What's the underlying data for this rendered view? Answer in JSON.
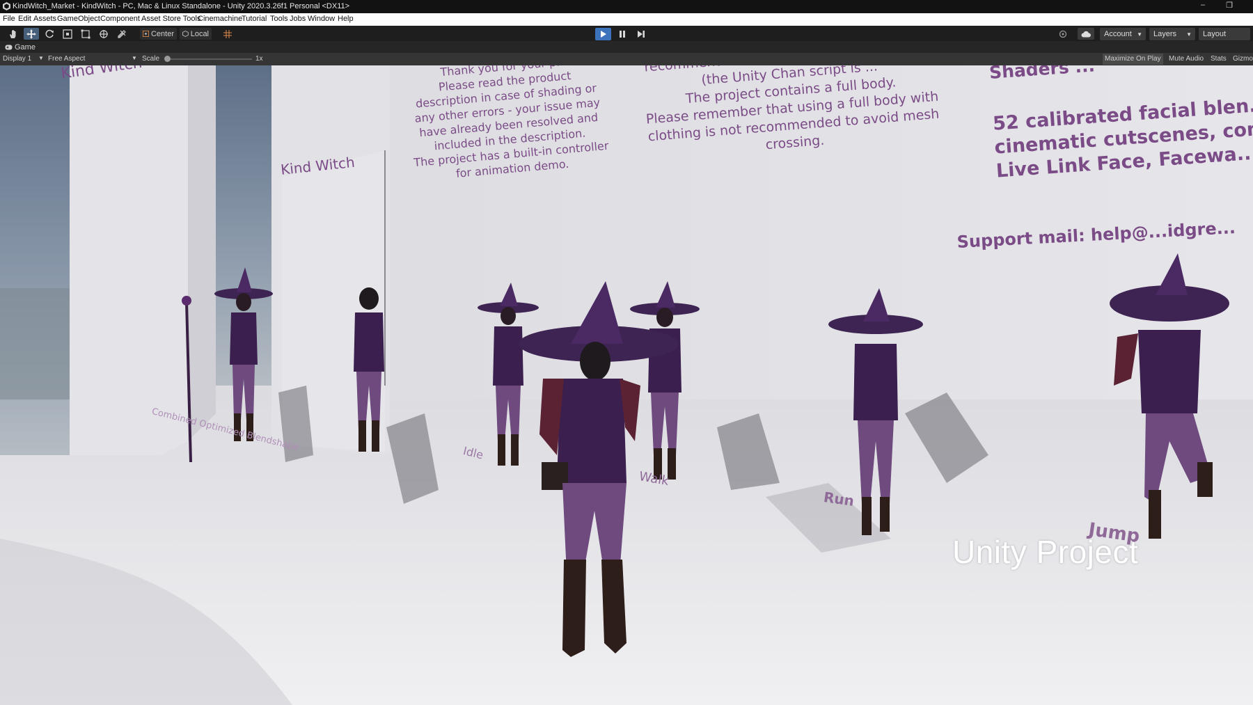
{
  "window": {
    "title": "KindWitch_Market - KindWitch - PC, Mac & Linux Standalone - Unity 2020.3.26f1 Personal <DX11>",
    "minimize_glyph": "–",
    "restore_glyph": "❐"
  },
  "menu": [
    "File",
    "Edit",
    "Assets",
    "GameObject",
    "Component",
    "Asset Store Tools",
    "Cinemachine",
    "Tutorial",
    "Tools",
    "Jobs",
    "Window",
    "Help"
  ],
  "toolbar": {
    "tools": [
      "hand-icon",
      "move-icon",
      "rotate-icon",
      "scale-icon",
      "rect-icon",
      "transform-icon",
      "custom-tool-icon"
    ],
    "pivot_label": "Center",
    "space_label": "Local",
    "account_label": "Account",
    "layers_label": "Layers",
    "layout_label": "Layout",
    "play_color": "#3d72bd"
  },
  "tab": {
    "label": "Game"
  },
  "game_bar": {
    "display": "Display 1",
    "aspect": "Free Aspect",
    "scale_label": "Scale",
    "scale_value": "1x",
    "maximize": "Maximize On Play",
    "mute": "Mute Audio",
    "stats": "Stats",
    "gizmos": "Gizmos"
  },
  "scene": {
    "wall_left_title": "Kind Witch",
    "pillar_title": "Kind Witch",
    "wall_text_1": [
      "Thank you for your p...",
      "Please read the product",
      "description in case of shading or",
      "any other errors - your issue may",
      "have already been resolved and",
      "included in the description.",
      "The project has a built-in controller",
      "for animation demo."
    ],
    "wall_text_2": [
      "recommended ... the Unity Chan script is ...",
      "(the Unity Chan script is ...",
      "The project contains a full body.",
      "Please remember that using a full body with",
      "clothing is not recommended to avoid mesh",
      "crossing."
    ],
    "wall_text_3": [
      "Shaders ...",
      "52 calibrated facial blen...",
      "cinematic cutscenes, com...",
      "Live Link Face, Facewa..."
    ],
    "support_text": "Support mail: help@...idgre...",
    "floor_labels": {
      "blendshape": "Combined Optimized Blendshape",
      "idle": "Idle",
      "walk": "Walk",
      "run": "Run",
      "jump": "Jump"
    },
    "witch_color": "#4b2a63",
    "tights_color": "#6e4a7e"
  },
  "watermark": "Unity Project"
}
